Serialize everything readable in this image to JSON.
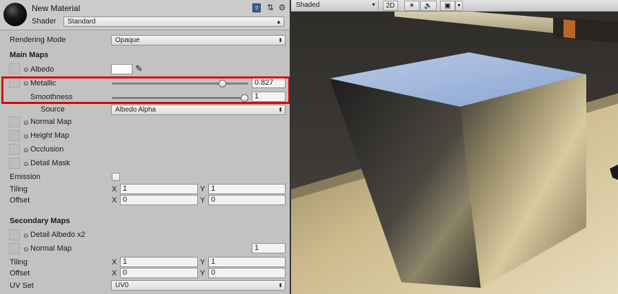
{
  "inspector": {
    "material_name": "New Material",
    "shader_label": "Shader",
    "shader_value": "Standard",
    "rendering_mode_label": "Rendering Mode",
    "rendering_mode_value": "Opaque",
    "main_maps_heading": "Main Maps",
    "albedo_label": "Albedo",
    "albedo_color": "#ffffff",
    "metallic_label": "Metallic",
    "metallic_value": "0.827",
    "metallic_fraction": 0.827,
    "smoothness_label": "Smoothness",
    "smoothness_value": "1",
    "smoothness_fraction": 1.0,
    "source_label": "Source",
    "source_value": "Albedo Alpha",
    "normal_map_label": "Normal Map",
    "height_map_label": "Height Map",
    "occlusion_label": "Occlusion",
    "detail_mask_label": "Detail Mask",
    "emission_label": "Emission",
    "tiling_label": "Tiling",
    "offset_label": "Offset",
    "x_label": "X",
    "y_label": "Y",
    "main_tiling": {
      "x": "1",
      "y": "1"
    },
    "main_offset": {
      "x": "0",
      "y": "0"
    },
    "secondary_maps_heading": "Secondary Maps",
    "detail_albedo_label": "Detail Albedo x2",
    "secondary_normal_map_label": "Normal Map",
    "secondary_normal_scale": "1",
    "secondary_tiling": {
      "x": "1",
      "y": "1"
    },
    "secondary_offset": {
      "x": "0",
      "y": "0"
    },
    "uv_set_label": "UV Set",
    "uv_set_value": "UV0",
    "highlight_color": "#e00000"
  },
  "scene_toolbar": {
    "shading_mode": "Shaded",
    "mode_2d": "2D",
    "icons": [
      "sun-icon",
      "speaker-icon",
      "image-icon"
    ]
  }
}
